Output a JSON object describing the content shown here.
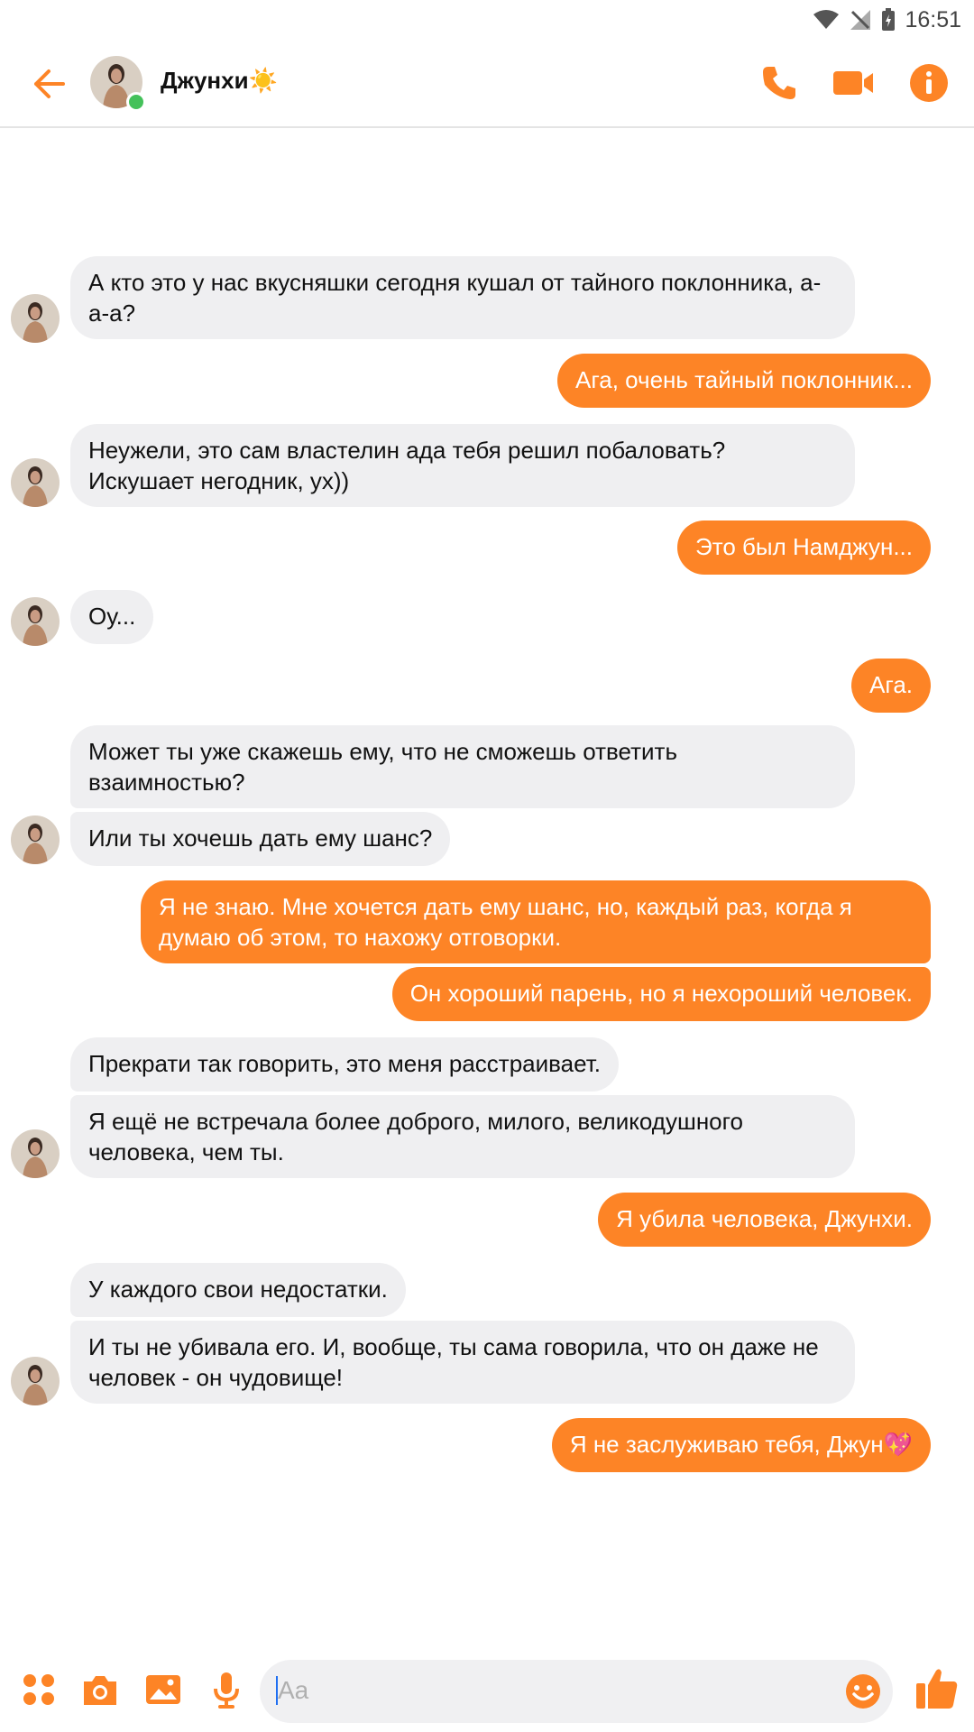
{
  "status_bar": {
    "time": "16:51"
  },
  "header": {
    "contact_name": "Джунхи☀️",
    "accent": "#fd8426"
  },
  "messages": [
    {
      "side": "in",
      "text": "А кто это у нас вкусняшки сегодня кушал от тайного поклонника, а-а-а?"
    },
    {
      "side": "out",
      "text": "Ага, очень тайный поклонник..."
    },
    {
      "side": "in",
      "text": "Неужели, это сам властелин ада тебя решил побаловать? Искушает негодник, ух))"
    },
    {
      "side": "out",
      "text": "Это был Намджун..."
    },
    {
      "side": "in",
      "text": "Оу..."
    },
    {
      "side": "out",
      "text": "Ага."
    },
    {
      "side": "in",
      "text": "Может ты уже скажешь ему, что не сможешь ответить взаимностью?"
    },
    {
      "side": "in",
      "text": "Или ты хочешь дать ему шанс?"
    },
    {
      "side": "out",
      "text": "Я не знаю. Мне хочется дать ему шанс, но, каждый раз, когда я думаю об этом, то нахожу отговорки."
    },
    {
      "side": "out",
      "text": "Он хороший парень, но я нехороший человек."
    },
    {
      "side": "in",
      "text": "Прекрати так говорить, это меня расстраивает."
    },
    {
      "side": "in",
      "text": "Я ещё не встречала более доброго, милого, великодушного человека, чем ты."
    },
    {
      "side": "out",
      "text": "Я убила человека, Джунхи."
    },
    {
      "side": "in",
      "text": "У каждого свои недостатки."
    },
    {
      "side": "in",
      "text": "И ты не убивала его. И, вообще, ты сама говорила, что он даже не человек - он чудовище!"
    },
    {
      "side": "out",
      "text": "Я не заслуживаю тебя, Джун💖"
    }
  ],
  "composer": {
    "placeholder": "Aa",
    "icons": [
      "apps-icon",
      "camera-icon",
      "gallery-icon",
      "microphone-icon",
      "emoji-icon",
      "thumbs-up-icon"
    ]
  }
}
